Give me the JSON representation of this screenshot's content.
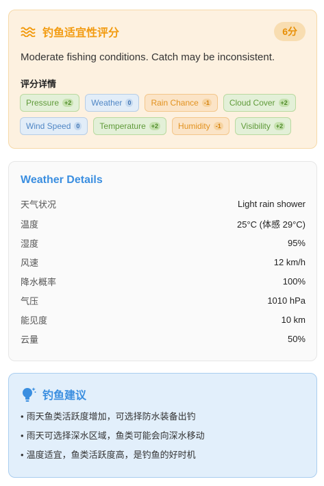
{
  "score_card": {
    "title": "钓鱼适宜性评分",
    "score": "6分",
    "description": "Moderate fishing conditions. Catch may be inconsistent.",
    "details_heading": "评分详情",
    "icon": "waves-icon",
    "factors": [
      {
        "label": "Pressure",
        "delta": "+2",
        "tone": "pos"
      },
      {
        "label": "Weather",
        "delta": "0",
        "tone": "neu"
      },
      {
        "label": "Rain Chance",
        "delta": "-1",
        "tone": "neg"
      },
      {
        "label": "Cloud Cover",
        "delta": "+2",
        "tone": "pos"
      },
      {
        "label": "Wind Speed",
        "delta": "0",
        "tone": "neu"
      },
      {
        "label": "Temperature",
        "delta": "+2",
        "tone": "pos"
      },
      {
        "label": "Humidity",
        "delta": "-1",
        "tone": "neg"
      },
      {
        "label": "Visibility",
        "delta": "+2",
        "tone": "pos"
      }
    ]
  },
  "weather": {
    "title": "Weather Details",
    "rows": [
      {
        "label": "天气状况",
        "value": "Light rain shower"
      },
      {
        "label": "温度",
        "value": "25°C (体感 29°C)"
      },
      {
        "label": "湿度",
        "value": "95%"
      },
      {
        "label": "风速",
        "value": "12 km/h"
      },
      {
        "label": "降水概率",
        "value": "100%"
      },
      {
        "label": "气压",
        "value": "1010 hPa"
      },
      {
        "label": "能见度",
        "value": "10 km"
      },
      {
        "label": "云量",
        "value": "50%"
      }
    ]
  },
  "advice": {
    "title": "钓鱼建议",
    "icon": "lightbulb-icon",
    "items": [
      "雨天鱼类活跃度增加，可选择防水装备出钓",
      "雨天可选择深水区域，鱼类可能会向深水移动",
      "温度适宜，鱼类活跃度高，是钓鱼的好时机"
    ]
  },
  "colors": {
    "accent_orange": "#f29b10",
    "accent_blue": "#3a8ee0",
    "positive": "#5f9a39",
    "neutral": "#4f86c5",
    "negative": "#e2921f"
  }
}
